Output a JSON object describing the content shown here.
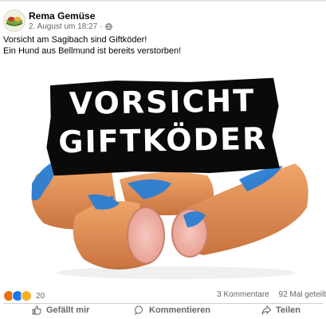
{
  "post": {
    "author": "Rema Gemüse",
    "date": "2. August um 18:27",
    "separator": "·",
    "privacy_icon": "globe-icon",
    "text_lines": [
      "Vorsicht am Sagibach sind Giftköder!",
      "Ein Hund aus Bellmund ist bereits verstorben!"
    ]
  },
  "image": {
    "line1": "VORSICHT",
    "line2": "GIFTKÖDER"
  },
  "stats": {
    "reaction_icons": [
      "angry-icon",
      "like-icon",
      "sad-icon"
    ],
    "reaction_count": "20",
    "comments": "3 Kommentare",
    "shares": "92 Mal geteilt"
  },
  "actions": {
    "like": "Gefällt mir",
    "comment": "Kommentieren",
    "share": "Teilen"
  },
  "colors": {
    "text_secondary": "#65676b",
    "like_blue": "#1877f2",
    "angry": "#e9710f",
    "sad": "#f7b125",
    "poison_blue": "#2a7fd4"
  }
}
